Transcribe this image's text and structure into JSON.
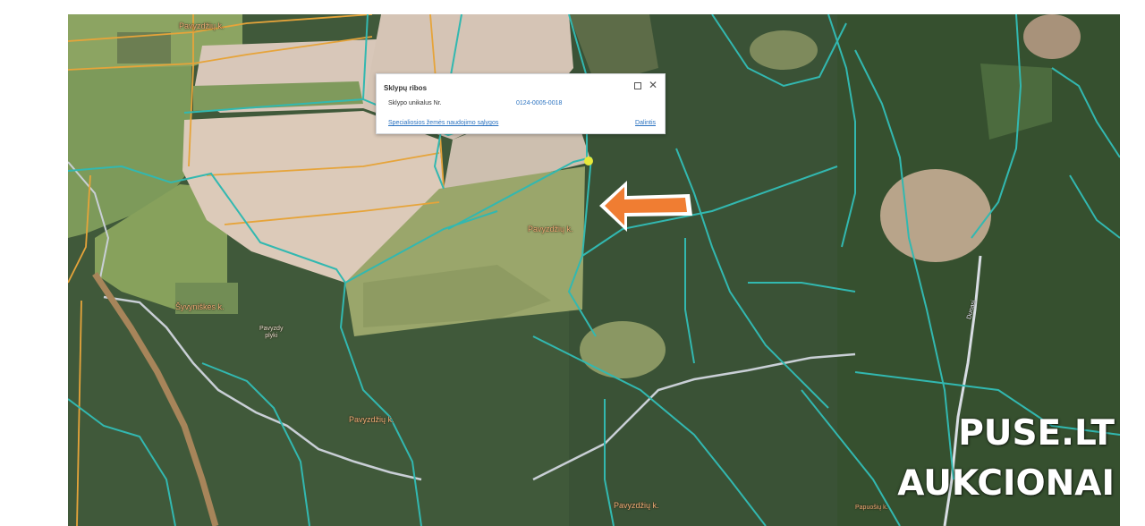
{
  "popup": {
    "title": "Sklypų ribos",
    "field_label": "Sklypo unikalus Nr.",
    "field_value": "0124-0005-0018",
    "link_label": "Specialiosios žemės naudojimo sąlygos",
    "share_label": "Dalintis"
  },
  "map_labels": {
    "village_top": "Pavyzdžių k.",
    "village_center": "Pavyzdžių k.",
    "village_left": "Šyvyniškės k.",
    "village_bottom_left": "Pavyzdžių k.",
    "village_bottom": "Pavyzdžių k.",
    "locality_small": "Pavyzdy\nplyki",
    "road_name": "Dunasi",
    "village_bottom_right": "Papuošių k."
  },
  "watermark": {
    "line1": "PUSE.LT",
    "line2": "AUKCIONAI"
  },
  "colors": {
    "parcel_boundary": "#32b8b0",
    "cadastral_line": "#e6a43a",
    "arrow": "#f07d32",
    "marker": "#e6e83a"
  }
}
